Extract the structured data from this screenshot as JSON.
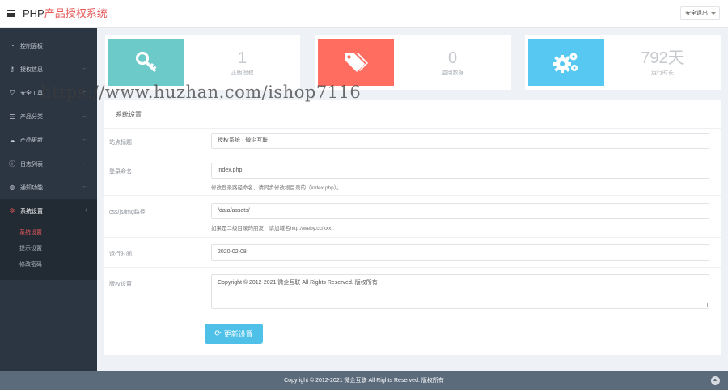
{
  "header": {
    "brand_prefix": "PHP",
    "brand_accent": "产品授权系统",
    "logout_label": "安全退出"
  },
  "sidebar": {
    "items": [
      {
        "icon": "dashboard-icon",
        "glyph": "◔",
        "label": "控制面板",
        "has_arrow": false
      },
      {
        "icon": "key-icon",
        "glyph": "⚷",
        "label": "授权信息",
        "has_arrow": true
      },
      {
        "icon": "shield-icon",
        "glyph": "⛉",
        "label": "安全工具",
        "has_arrow": true
      },
      {
        "icon": "list-icon",
        "glyph": "☰",
        "label": "产品分类",
        "has_arrow": true
      },
      {
        "icon": "cloud-upload-icon",
        "glyph": "☁",
        "label": "产品更新",
        "has_arrow": true
      },
      {
        "icon": "info-icon",
        "glyph": "ⓘ",
        "label": "日志列表",
        "has_arrow": true
      },
      {
        "icon": "globe-icon",
        "glyph": "◍",
        "label": "通知功能",
        "has_arrow": true
      },
      {
        "icon": "cogs-icon",
        "glyph": "✲",
        "label": "系统设置",
        "has_arrow": true,
        "active": true
      }
    ],
    "submenu": [
      "系统设置",
      "提示设置",
      "修改密码"
    ],
    "arrow_glyph": "←",
    "arrow_open_glyph": "↓"
  },
  "stats": [
    {
      "value": "1",
      "label": "正版授权",
      "color": "#6ccac9",
      "icon": "key-icon"
    },
    {
      "value": "0",
      "label": "盗用数据",
      "color": "#ff6c60",
      "icon": "tag-icon"
    },
    {
      "value": "792天",
      "label": "运行时长",
      "color": "#57c8f2",
      "icon": "cogs-icon"
    }
  ],
  "panel": {
    "title": "系统设置",
    "fields": [
      {
        "label": "站点标题",
        "value": "授权系统 · 微企互联"
      },
      {
        "label": "登录命名",
        "value": "index.php",
        "hint": "修改登录路径命名，请同步修改根目录的（index.php）。"
      },
      {
        "label": "css/js/img路径",
        "value": "/data/assets/",
        "hint": "如果是二级目录的朋友，请加域名http://weby.cc/xxx ."
      },
      {
        "label": "运行时间",
        "value": "2020-02-08"
      },
      {
        "label": "版权设置",
        "value": "Copyright © 2012-2021 微企互联 All Rights Reserved. 版权所有"
      }
    ],
    "save_label": "更新设置",
    "save_glyph": "⟳"
  },
  "footer": {
    "text": "Copyright © 2012-2021 微企互联 All Rights Reserved. 版权所有"
  },
  "watermark": "https://www.huzhan.com/ishop7116",
  "colors": {
    "accent": "#e85a5a",
    "sidebar_bg": "#2c3542",
    "button": "#4fc1e9"
  }
}
